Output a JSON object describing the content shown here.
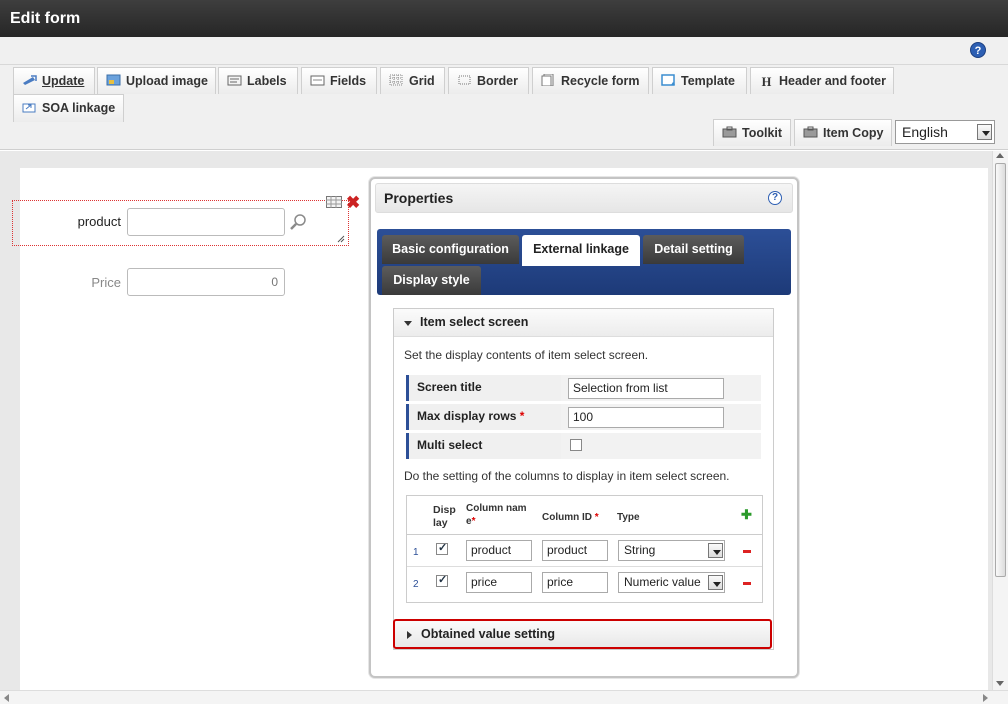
{
  "window": {
    "title": "Edit form"
  },
  "help": {
    "icon": "help-icon"
  },
  "toolbar": {
    "buttons": [
      {
        "label": "Update",
        "icon": "update-icon"
      },
      {
        "label": "Upload image",
        "icon": "upload-image-icon"
      },
      {
        "label": "Labels",
        "icon": "labels-icon"
      },
      {
        "label": "Fields",
        "icon": "fields-icon"
      },
      {
        "label": "Grid",
        "icon": "grid-icon"
      },
      {
        "label": "Border",
        "icon": "border-icon"
      },
      {
        "label": "Recycle form",
        "icon": "recycle-form-icon"
      },
      {
        "label": "Template",
        "icon": "template-icon"
      },
      {
        "label": "Header and footer",
        "icon": "header-footer-icon"
      },
      {
        "label": "SOA linkage",
        "icon": "soa-linkage-icon"
      }
    ],
    "toolkit_label": "Toolkit",
    "item_copy_label": "Item Copy",
    "language": "English"
  },
  "form": {
    "product_label": "product",
    "price_label": "Price",
    "price_value": "0"
  },
  "properties": {
    "title": "Properties",
    "tabs": [
      "Basic configuration",
      "External linkage",
      "Detail setting",
      "Display style"
    ],
    "section_title": "Item select screen",
    "section_desc": "Set the display contents of item select screen.",
    "screen_title_label": "Screen title",
    "screen_title_value": "Selection from list",
    "max_rows_label": "Max display rows",
    "max_rows_value": "100",
    "multi_select_label": "Multi select",
    "multi_select_checked": false,
    "columns_desc": "Do the setting of the columns to display in item select screen.",
    "col_headers": {
      "display_1": "Disp",
      "display_2": "lay",
      "name_1": "Column nam",
      "name_2": "e",
      "id": "Column ID",
      "type": "Type"
    },
    "rows": [
      {
        "num": "1",
        "display": true,
        "name": "product",
        "id": "product",
        "type": "String"
      },
      {
        "num": "2",
        "display": true,
        "name": "price",
        "id": "price",
        "type": "Numeric value"
      }
    ],
    "obtained_title": "Obtained value setting"
  },
  "colors": {
    "accent": "#2c4f97",
    "highlight": "#cc0000",
    "titlebar": "#2f2f2f"
  }
}
